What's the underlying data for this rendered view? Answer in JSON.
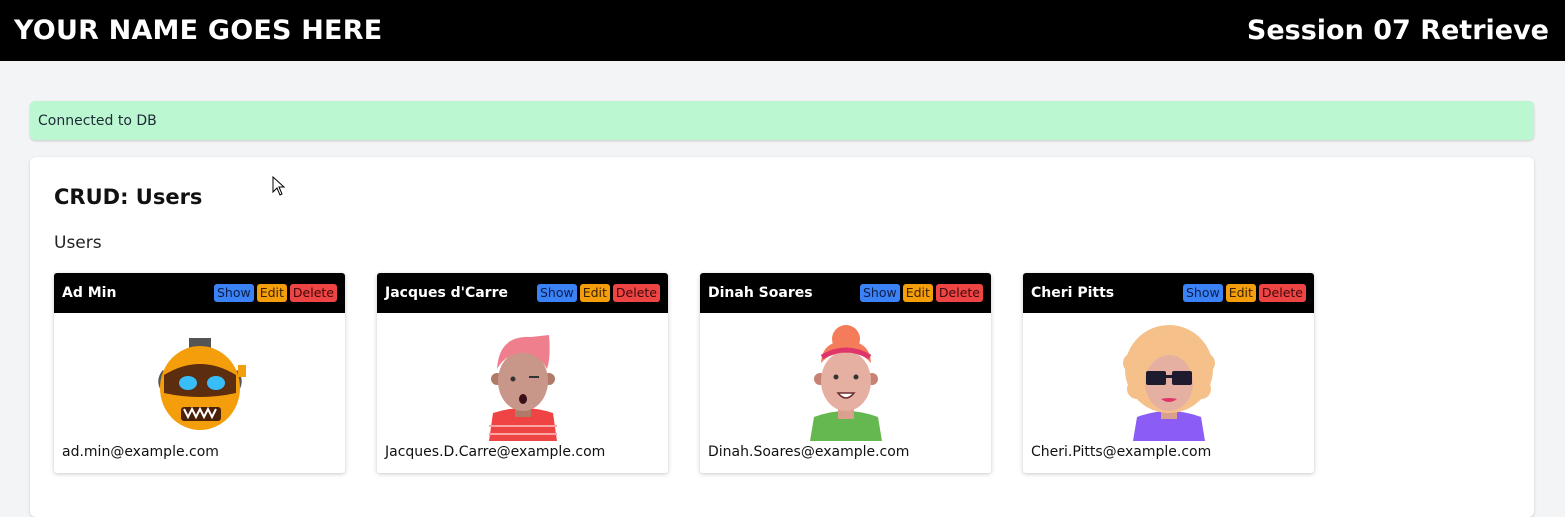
{
  "header": {
    "brand": "YOUR NAME GOES HERE",
    "session": "Session 07 Retrieve"
  },
  "alert": {
    "message": "Connected to DB",
    "color": "#bbf7d0"
  },
  "main": {
    "title": "CRUD: Users",
    "section": "Users",
    "buttons": {
      "show": "Show",
      "edit": "Edit",
      "delete": "Delete"
    },
    "users": [
      {
        "name": "Ad Min",
        "email": "ad.min@example.com",
        "avatar": "robot-avatar-icon"
      },
      {
        "name": "Jacques d'Carre",
        "email": "Jacques.D.Carre@example.com",
        "avatar": "old-man-pink-hair-avatar-icon"
      },
      {
        "name": "Dinah Soares",
        "email": "Dinah.Soares@example.com",
        "avatar": "woman-red-hair-avatar-icon"
      },
      {
        "name": "Cheri Pitts",
        "email": "Cheri.Pitts@example.com",
        "avatar": "woman-curly-hair-sunglasses-avatar-icon"
      }
    ]
  },
  "colors": {
    "show": "#3b82f6",
    "edit": "#f59e0b",
    "delete": "#ef4444",
    "header": "#000000"
  }
}
